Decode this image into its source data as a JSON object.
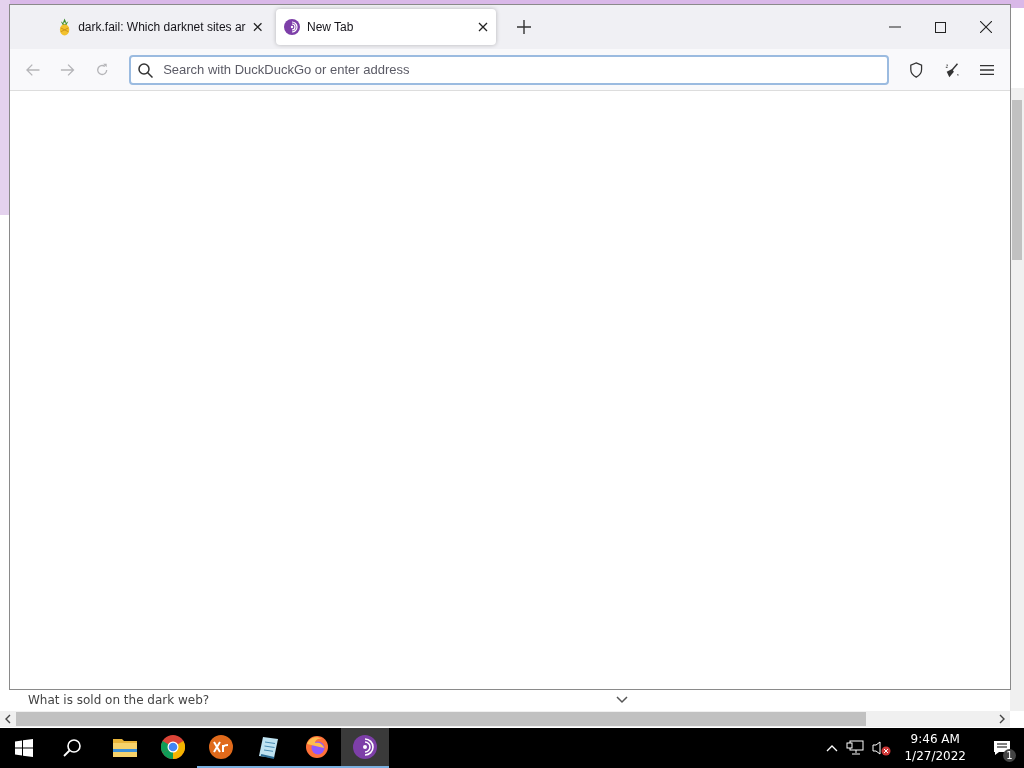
{
  "tabs": [
    {
      "title": "dark.fail: Which darknet sites ar",
      "selected": false
    },
    {
      "title": "New Tab",
      "selected": true
    }
  ],
  "address_bar": {
    "placeholder": "Search with DuckDuckGo or enter address"
  },
  "background_page": {
    "question": "What is sold on the dark web?"
  },
  "taskbar": {
    "apps": [
      {
        "kind": "folder",
        "running": false,
        "active": false
      },
      {
        "kind": "chrome",
        "running": false,
        "active": false
      },
      {
        "kind": "xr",
        "running": true,
        "active": false
      },
      {
        "kind": "notepad",
        "running": true,
        "active": false
      },
      {
        "kind": "firefox",
        "running": true,
        "active": false
      },
      {
        "kind": "tor",
        "running": true,
        "active": true
      }
    ],
    "time": "9:46 AM",
    "date": "1/27/2022",
    "notification_count": "1"
  }
}
